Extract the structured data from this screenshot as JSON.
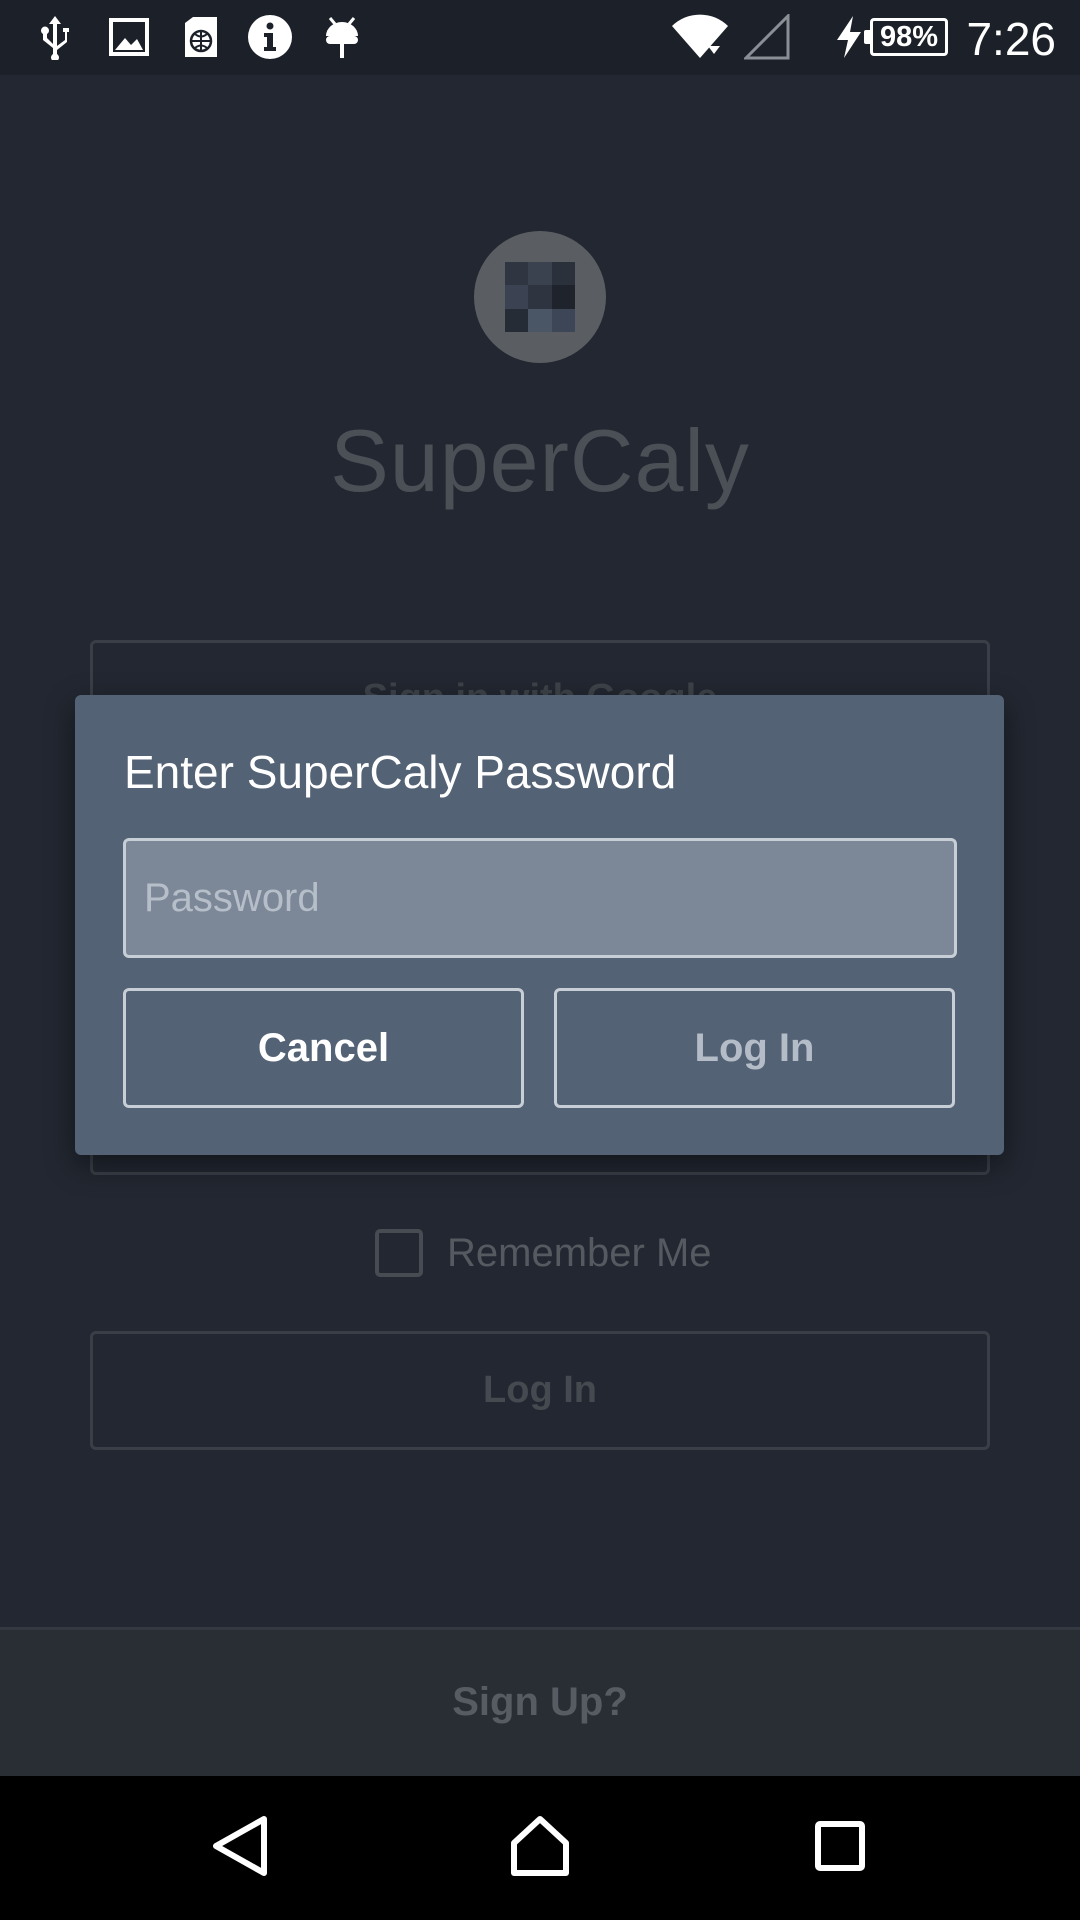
{
  "status_bar": {
    "time": "7:26",
    "battery": "98%",
    "icons": [
      "usb-icon",
      "image-icon",
      "sim-globe-icon",
      "info-icon",
      "android-debug-icon",
      "wifi-icon",
      "cell-signal-icon",
      "charging-bolt-icon",
      "battery-icon"
    ]
  },
  "app": {
    "name": "SuperCaly",
    "google_button": "Sign in with Google",
    "remember_label": "Remember Me",
    "login_button": "Log In",
    "signup_link": "Sign Up?"
  },
  "dialog": {
    "title": "Enter SuperCaly Password",
    "password_placeholder": "Password",
    "password_value": "",
    "cancel_label": "Cancel",
    "login_label": "Log In"
  },
  "colors": {
    "background": "#222731",
    "dialog": "#546275",
    "input_fill": "#7c8898"
  },
  "navigation": {
    "icons": [
      "back-icon",
      "home-icon",
      "recents-icon"
    ]
  }
}
